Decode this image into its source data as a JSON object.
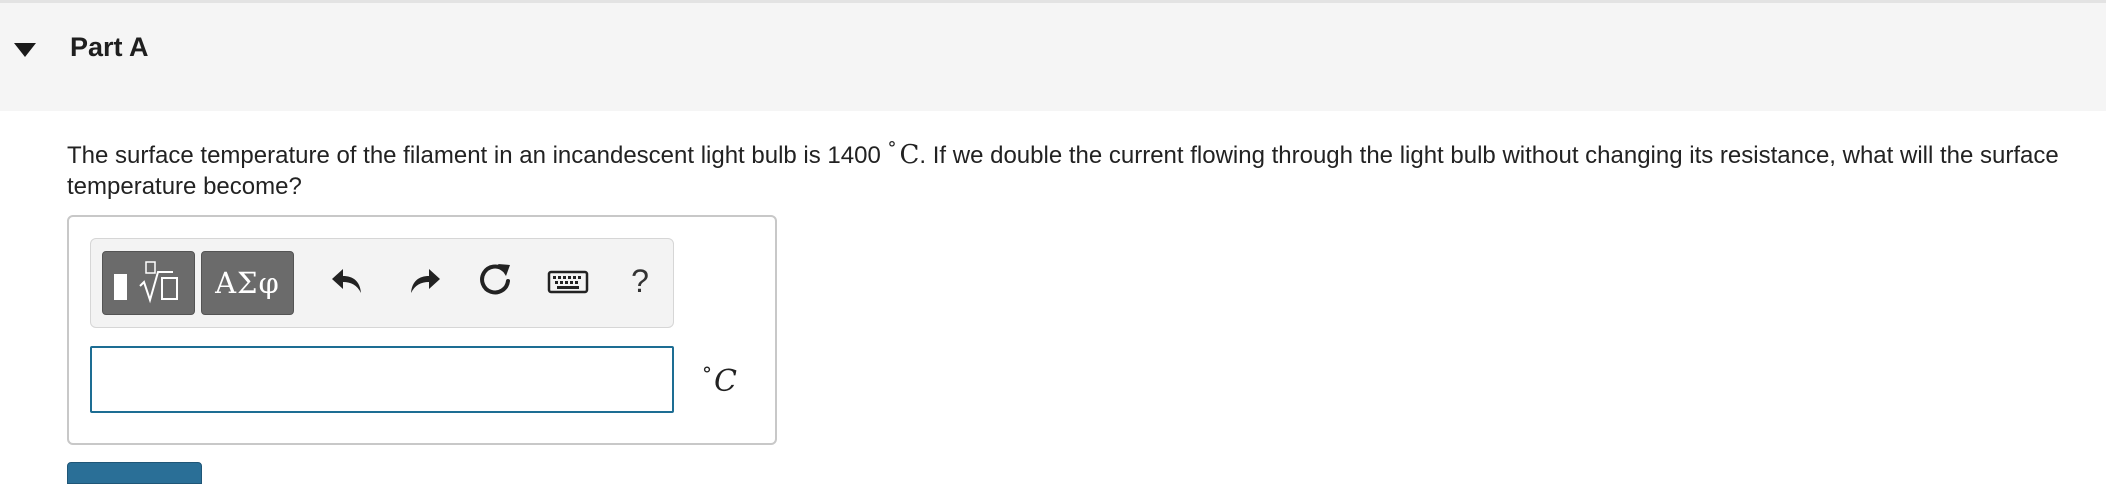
{
  "part": {
    "title": "Part A",
    "expanded": true
  },
  "question": {
    "text_before": "The surface temperature of the filament in an incandescent light bulb is 1400",
    "degree_symbol": "°",
    "unit_symbol": "C",
    "text_after": ".  If we double the current flowing through the light bulb without changing its resistance, what will the surface temperature become?"
  },
  "toolbar": {
    "templates_icon": "templates-sqrt-icon",
    "symbols_label": "ΑΣφ",
    "undo_icon": "undo-icon",
    "redo_icon": "redo-icon",
    "reset_icon": "reset-icon",
    "keyboard_icon": "keyboard-icon",
    "help_label": "?"
  },
  "answer": {
    "value": "",
    "placeholder": "",
    "unit_degree": "°",
    "unit_symbol": "C"
  },
  "colors": {
    "header_bg": "#f5f5f5",
    "input_border": "#1d6d93",
    "toolbar_button": "#6b6b6b",
    "submit_button": "#2a6f97"
  }
}
